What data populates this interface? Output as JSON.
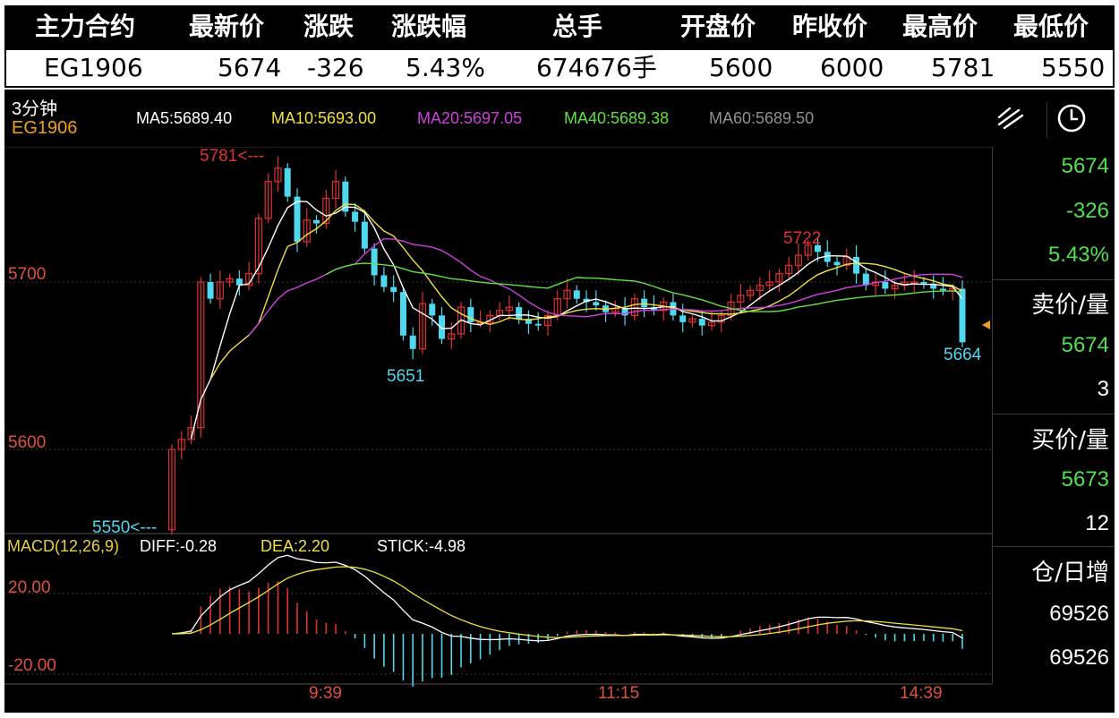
{
  "quote": {
    "headers": [
      "主力合约",
      "最新价",
      "涨跌",
      "涨跌幅",
      "总手",
      "开盘价",
      "昨收价",
      "最高价",
      "最低价"
    ],
    "values": [
      "EG1906",
      "5674",
      "-326",
      "5.43%",
      "674676手",
      "5600",
      "6000",
      "5781",
      "5550"
    ]
  },
  "toolbar": {
    "period": "3分钟",
    "symbol": "EG1906",
    "ma": [
      {
        "label": "MA5:5689.40",
        "color": "#ffffff"
      },
      {
        "label": "MA10:5693.00",
        "color": "#f0e040"
      },
      {
        "label": "MA20:5697.05",
        "color": "#d040e0"
      },
      {
        "label": "MA40:5689.38",
        "color": "#60e040"
      },
      {
        "label": "MA60:5689.50",
        "color": "#909090"
      }
    ],
    "icons": [
      "draw-line-icon",
      "clock-icon"
    ]
  },
  "price_axis": {
    "labels": [
      "5700",
      "5600"
    ]
  },
  "annotations": {
    "high": "5781<---",
    "low": "5550<---",
    "local_high": "5722",
    "local_low": "5651",
    "last": "5664"
  },
  "side_panel": {
    "price": "5674",
    "change": "-326",
    "change_pct": "5.43%",
    "ask_label": "卖价/量",
    "ask_price": "5674",
    "ask_vol": "3",
    "bid_label": "买价/量",
    "bid_price": "5673",
    "bid_vol": "12",
    "oi_label": "仓/日增",
    "oi": "69526",
    "oi_change": "69526"
  },
  "macd": {
    "title": "MACD(12,26,9)",
    "diff": "DIFF:-0.28",
    "dea": "DEA:2.20",
    "stick": "STICK:-4.98",
    "axis_labels": [
      "20.00",
      "-20.00"
    ]
  },
  "time_axis": [
    "9:39",
    "11:15",
    "14:39"
  ],
  "colors": {
    "up": "#e03030",
    "down": "#50d8f0",
    "green_text": "#50e050",
    "red_text": "#e03030",
    "ma5": "#ffffff",
    "ma10": "#f0e040",
    "ma20": "#d040e0",
    "ma40": "#60e040"
  }
}
